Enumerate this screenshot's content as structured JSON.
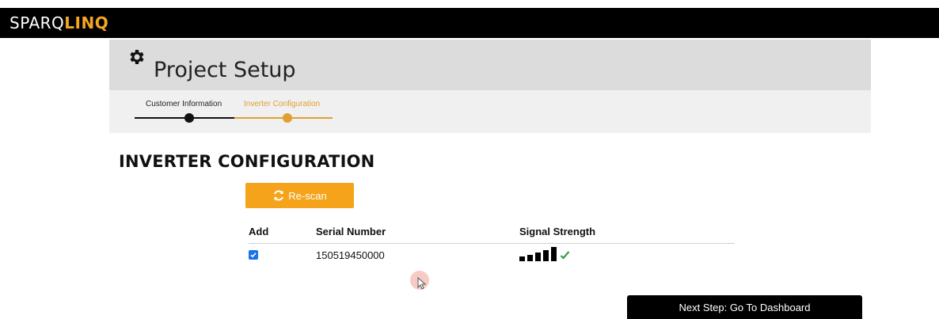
{
  "header": {
    "brand_part1": "SPARQ",
    "brand_part2": "LINQ",
    "brand_accent": "#f5a623"
  },
  "project": {
    "title": "Project Setup",
    "icon": "gear-icon"
  },
  "steps": [
    {
      "label": "Customer Information",
      "state": "complete",
      "color": "#111111"
    },
    {
      "label": "Inverter Configuration",
      "state": "active",
      "color": "#e0a030"
    }
  ],
  "section": {
    "title": "INVERTER CONFIGURATION"
  },
  "rescan": {
    "label": "Re-scan",
    "icon": "refresh-icon",
    "color": "#f5a31a"
  },
  "table": {
    "headers": [
      "Add",
      "Serial Number",
      "Signal Strength"
    ],
    "rows": [
      {
        "add_checked": true,
        "serial": "150519450000",
        "signal_bars": 5,
        "signal_ok": true
      }
    ]
  },
  "footer": {
    "next_label": "Next Step: Go To Dashboard"
  }
}
